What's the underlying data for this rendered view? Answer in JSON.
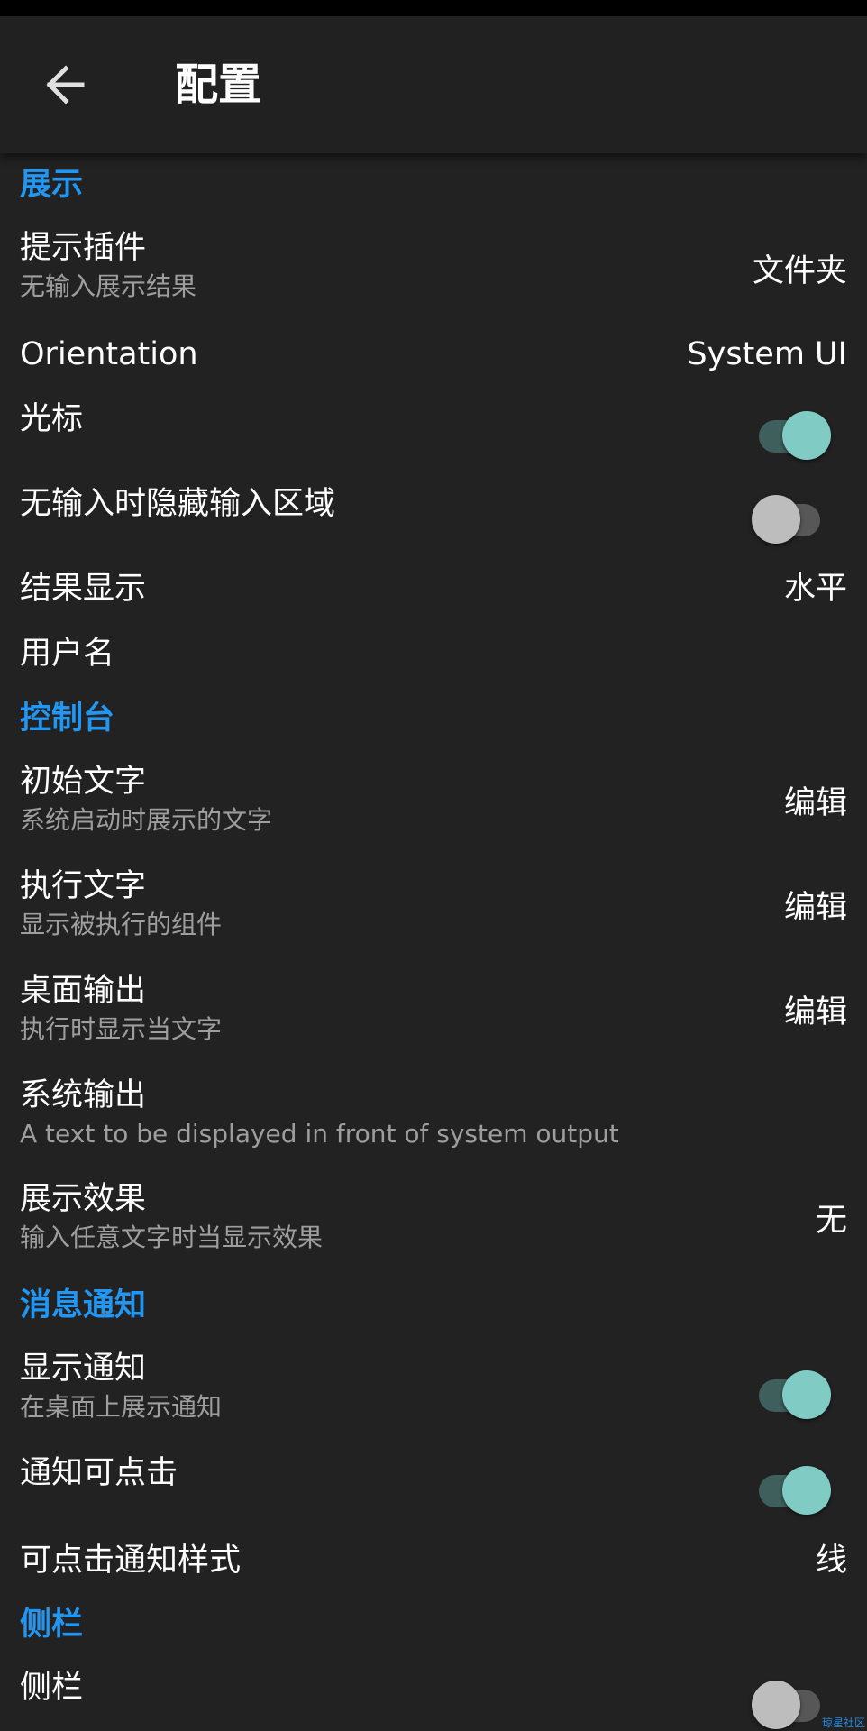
{
  "appbar": {
    "title": "配置",
    "back_icon": "arrow-back-icon"
  },
  "colors": {
    "background": "#222222",
    "section_title": "#2196f3",
    "switch_on_thumb": "#80cbc4",
    "switch_on_track": "#3f5f5c",
    "switch_off_thumb": "#bdbdbd",
    "switch_off_track": "#575757"
  },
  "display": {
    "header": "展示",
    "hint_plugin": {
      "title": "提示插件",
      "subtitle": "无输入展示结果",
      "value": "文件夹"
    },
    "orientation": {
      "title": "Orientation",
      "value": "System UI"
    },
    "cursor": {
      "title": "光标",
      "checked": true
    },
    "hide_input": {
      "title": "无输入时隐藏输入区域",
      "checked": false
    },
    "result_display": {
      "title": "结果显示",
      "value": "水平"
    },
    "username": {
      "title": "用户名"
    }
  },
  "console": {
    "header": "控制台",
    "initial_text": {
      "title": "初始文字",
      "subtitle": "系统启动时展示的文字",
      "value": "编辑"
    },
    "exec_text": {
      "title": "执行文字",
      "subtitle": "显示被执行的组件",
      "value": "编辑"
    },
    "desktop_output": {
      "title": "桌面输出",
      "subtitle": "执行时显示当文字",
      "value": "编辑"
    },
    "system_output": {
      "title": "系统输出",
      "subtitle": "A text to be displayed in front of system output"
    },
    "display_effect": {
      "title": "展示效果",
      "subtitle": "输入任意文字时当显示效果",
      "value": "无"
    }
  },
  "notifications": {
    "header": "消息通知",
    "show_notifications": {
      "title": "显示通知",
      "subtitle": "在桌面上展示通知",
      "checked": true
    },
    "clickable": {
      "title": "通知可点击",
      "checked": true
    },
    "clickable_style": {
      "title": "可点击通知样式",
      "value": "线"
    }
  },
  "sidebar": {
    "header": "侧栏",
    "sidebar_toggle": {
      "title": "侧栏",
      "checked": false
    }
  },
  "watermark": "琼星社区"
}
